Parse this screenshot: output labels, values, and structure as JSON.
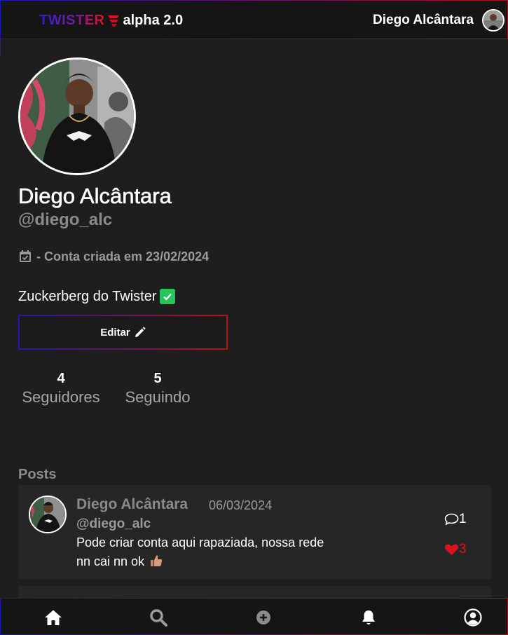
{
  "header": {
    "brand": "TWISTER",
    "version": "alpha 2.0",
    "user_name": "Diego Alcântara"
  },
  "profile": {
    "name": "Diego Alcântara",
    "handle": "@diego_alc",
    "created_text": "- Conta criada em 23/02/2024",
    "bio": "Zuckerberg do Twister",
    "edit_label": "Editar",
    "followers_count": "4",
    "followers_label": "Seguidores",
    "following_count": "5",
    "following_label": "Seguindo"
  },
  "posts": {
    "heading": "Posts",
    "items": [
      {
        "author": "Diego Alcântara",
        "date": "06/03/2024",
        "handle": "@diego_alc",
        "text_line1": "Pode criar conta aqui rapaziada, nossa rede",
        "text_line2": "nn cai nn ok",
        "comments": "1",
        "likes": "3"
      }
    ]
  },
  "nav": {
    "items": [
      "home-icon",
      "search-icon",
      "add-icon",
      "bell-icon",
      "profile-icon"
    ]
  },
  "colors": {
    "background": "#1e1e1e",
    "bar": "#151515",
    "card": "#262626",
    "accent_blue": "#2418a8",
    "accent_red": "#e0101a",
    "check_green": "#24c45a"
  }
}
